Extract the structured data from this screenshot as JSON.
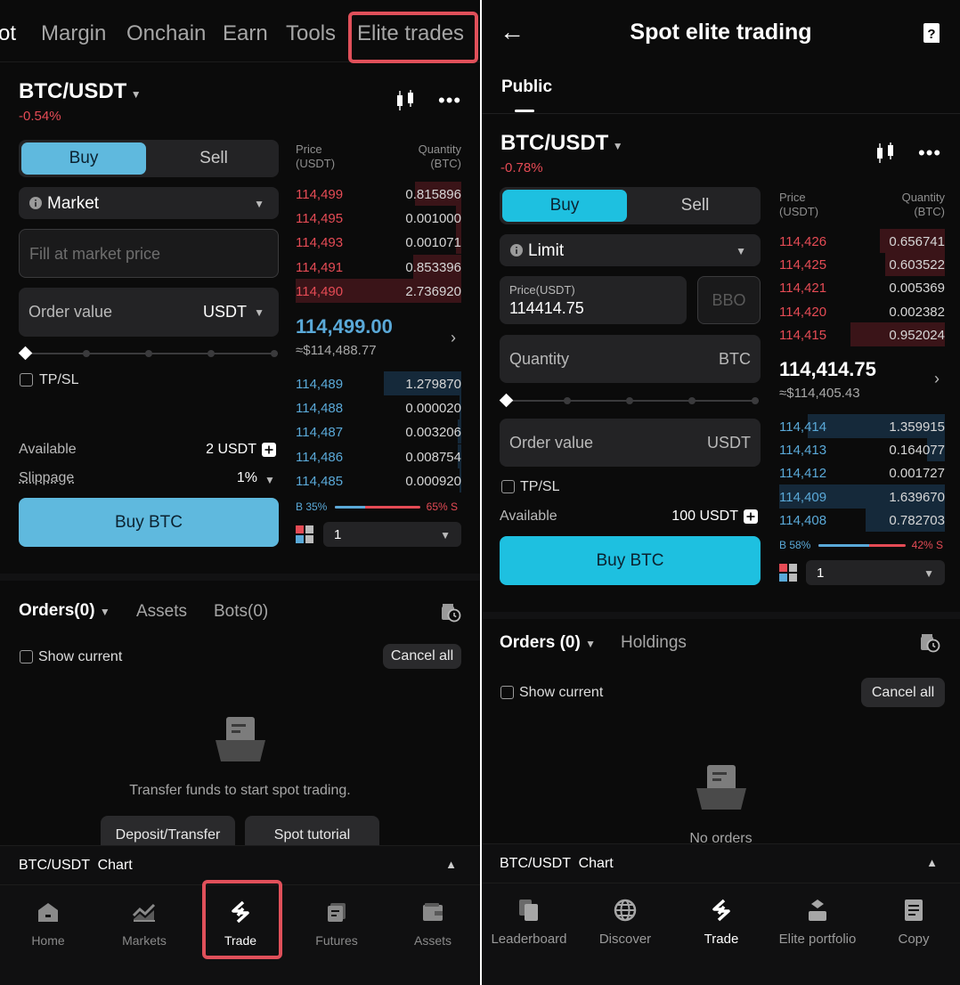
{
  "left": {
    "topnav": {
      "items": [
        "ot",
        "Margin",
        "Onchain",
        "Earn",
        "Tools",
        "Elite trades"
      ]
    },
    "pair": "BTC/USDT",
    "change": "-0.54%",
    "side_buy": "Buy",
    "side_sell": "Sell",
    "order_type": "Market",
    "market_price_placeholder": "Fill at market price",
    "order_value_label": "Order value",
    "order_value_unit": "USDT",
    "tpsl_label": "TP/SL",
    "available_label": "Available",
    "available_value": "2 USDT",
    "slippage_label": "Slippage",
    "slippage_value": "1%",
    "buy_button": "Buy BTC",
    "orderbook": {
      "price_header": "Price\n(USDT)",
      "qty_header": "Quantity\n(BTC)",
      "asks": [
        {
          "price": "114,499",
          "qty": "0.815896",
          "depth": 0.28
        },
        {
          "price": "114,495",
          "qty": "0.001000",
          "depth": 0.03
        },
        {
          "price": "114,493",
          "qty": "0.001071",
          "depth": 0.03
        },
        {
          "price": "114,491",
          "qty": "0.853396",
          "depth": 0.29
        },
        {
          "price": "114,490",
          "qty": "2.736920",
          "depth": 1.0
        }
      ],
      "last_price": "114,499.00",
      "last_price_fiat": "≈$114,488.77",
      "bids": [
        {
          "price": "114,489",
          "qty": "1.279870",
          "depth": 0.47
        },
        {
          "price": "114,488",
          "qty": "0.000020",
          "depth": 0.01
        },
        {
          "price": "114,487",
          "qty": "0.003206",
          "depth": 0.02
        },
        {
          "price": "114,486",
          "qty": "0.008754",
          "depth": 0.02
        },
        {
          "price": "114,485",
          "qty": "0.000920",
          "depth": 0.01
        }
      ],
      "buy_ratio": "B 35%",
      "sell_ratio": "65% S",
      "buy_ratio_value": 0.35,
      "depth_step": "1"
    },
    "orders_tab": "Orders(0)",
    "assets_tab": "Assets",
    "bots_tab": "Bots(0)",
    "show_current": "Show current",
    "cancel_all": "Cancel all",
    "empty_text": "Transfer funds to start spot trading.",
    "deposit_button": "Deposit/Transfer",
    "tutorial_button": "Spot tutorial",
    "chart_label": "BTC/USDT  Chart",
    "bottomnav": [
      "Home",
      "Markets",
      "Trade",
      "Futures",
      "Assets"
    ]
  },
  "right": {
    "title": "Spot elite trading",
    "tab_public": "Public",
    "pair": "BTC/USDT",
    "change": "-0.78%",
    "side_buy": "Buy",
    "side_sell": "Sell",
    "order_type": "Limit",
    "price_label": "Price(USDT)",
    "price_value": "114414.75",
    "bbo": "BBO",
    "quantity_label": "Quantity",
    "quantity_unit": "BTC",
    "order_value_label": "Order value",
    "order_value_unit": "USDT",
    "tpsl_label": "TP/SL",
    "available_label": "Available",
    "available_value": "100 USDT",
    "buy_button": "Buy BTC",
    "orderbook": {
      "price_header": "Price\n(USDT)",
      "qty_header": "Quantity\n(BTC)",
      "asks": [
        {
          "price": "114,426",
          "qty": "0.656741",
          "depth": 0.39
        },
        {
          "price": "114,425",
          "qty": "0.603522",
          "depth": 0.36
        },
        {
          "price": "114,421",
          "qty": "0.005369",
          "depth": 0.0
        },
        {
          "price": "114,420",
          "qty": "0.002382",
          "depth": 0.0
        },
        {
          "price": "114,415",
          "qty": "0.952024",
          "depth": 0.57
        }
      ],
      "last_price": "114,414.75",
      "last_price_fiat": "≈$114,405.43",
      "bids": [
        {
          "price": "114,414",
          "qty": "1.359915",
          "depth": 0.83
        },
        {
          "price": "114,413",
          "qty": "0.164077",
          "depth": 0.11
        },
        {
          "price": "114,412",
          "qty": "0.001727",
          "depth": 0.0
        },
        {
          "price": "114,409",
          "qty": "1.639670",
          "depth": 1.0
        },
        {
          "price": "114,408",
          "qty": "0.782703",
          "depth": 0.48
        }
      ],
      "buy_ratio": "B 58%",
      "sell_ratio": "42% S",
      "buy_ratio_value": 0.58,
      "depth_step": "1"
    },
    "orders_tab": "Orders (0)",
    "holdings_tab": "Holdings",
    "show_current": "Show current",
    "cancel_all": "Cancel all",
    "empty_text": "No orders",
    "chart_label": "BTC/USDT  Chart",
    "bottomnav": [
      "Leaderboard",
      "Discover",
      "Trade",
      "Elite portfolio",
      "Copy"
    ]
  },
  "colors": {
    "accent_blue_left": "#5fb9de",
    "accent_blue_right": "#1ec0e0",
    "ask_red": "#e54b55",
    "bid_blue": "#5aa9d8",
    "highlight": "#e0505a"
  }
}
